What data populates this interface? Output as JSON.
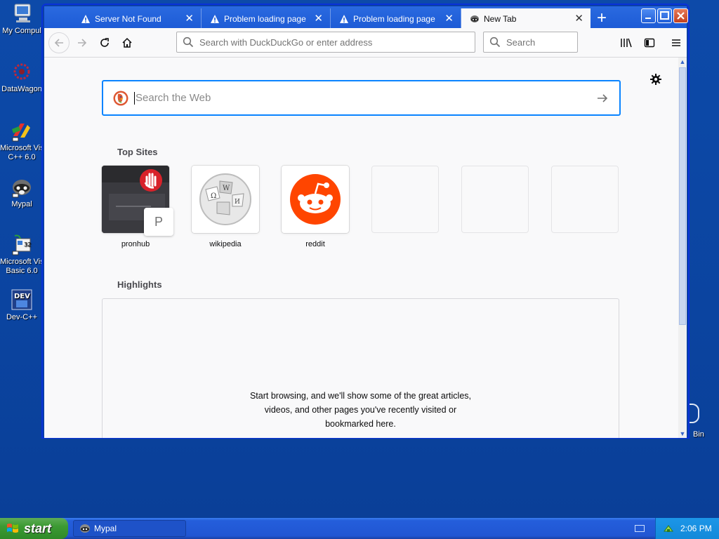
{
  "desktop": {
    "icons": [
      {
        "label": "My Compul",
        "icon": "my-computer-icon"
      },
      {
        "label": "DataWagon",
        "icon": "datawagon-icon"
      },
      {
        "label": "Microsoft Vis\nC++ 6.0",
        "icon": "visual-cpp-icon"
      },
      {
        "label": "Mypal",
        "icon": "mypal-icon"
      },
      {
        "label": "Microsoft Vis\nBasic 6.0",
        "icon": "visual-basic-icon"
      },
      {
        "label": "Dev-C++",
        "icon": "dev-cpp-icon"
      }
    ],
    "recycle_label": "Bin"
  },
  "browser": {
    "tabs": [
      {
        "title": "Server Not Found",
        "icon": "warning-icon",
        "active": false
      },
      {
        "title": "Problem loading page",
        "icon": "warning-icon",
        "active": false
      },
      {
        "title": "Problem loading page",
        "icon": "warning-icon",
        "active": false
      },
      {
        "title": "New Tab",
        "icon": "mypal-icon",
        "active": true
      }
    ],
    "new_tab_label": "+",
    "address_placeholder": "Search with DuckDuckGo or enter address",
    "search_placeholder": "Search"
  },
  "newtab": {
    "search_placeholder": "Search the Web",
    "top_sites_title": "Top Sites",
    "top_sites": [
      {
        "label": "pronhub",
        "badge": "P"
      },
      {
        "label": "wikipedia"
      },
      {
        "label": "reddit"
      },
      {
        "label": ""
      },
      {
        "label": ""
      },
      {
        "label": ""
      }
    ],
    "highlights_title": "Highlights",
    "highlights_message": [
      "Start browsing, and we'll show some of the great articles,",
      "videos, and other pages you've recently visited or",
      "bookmarked here."
    ]
  },
  "taskbar": {
    "start_label": "start",
    "task_label": "Mypal",
    "clock": "2:06 PM"
  },
  "colors": {
    "desktop_blue": "#0c48a8",
    "focus_blue": "#0a84ff",
    "reddit_orange": "#ff4500",
    "duckduckgo_orange": "#de5833"
  }
}
